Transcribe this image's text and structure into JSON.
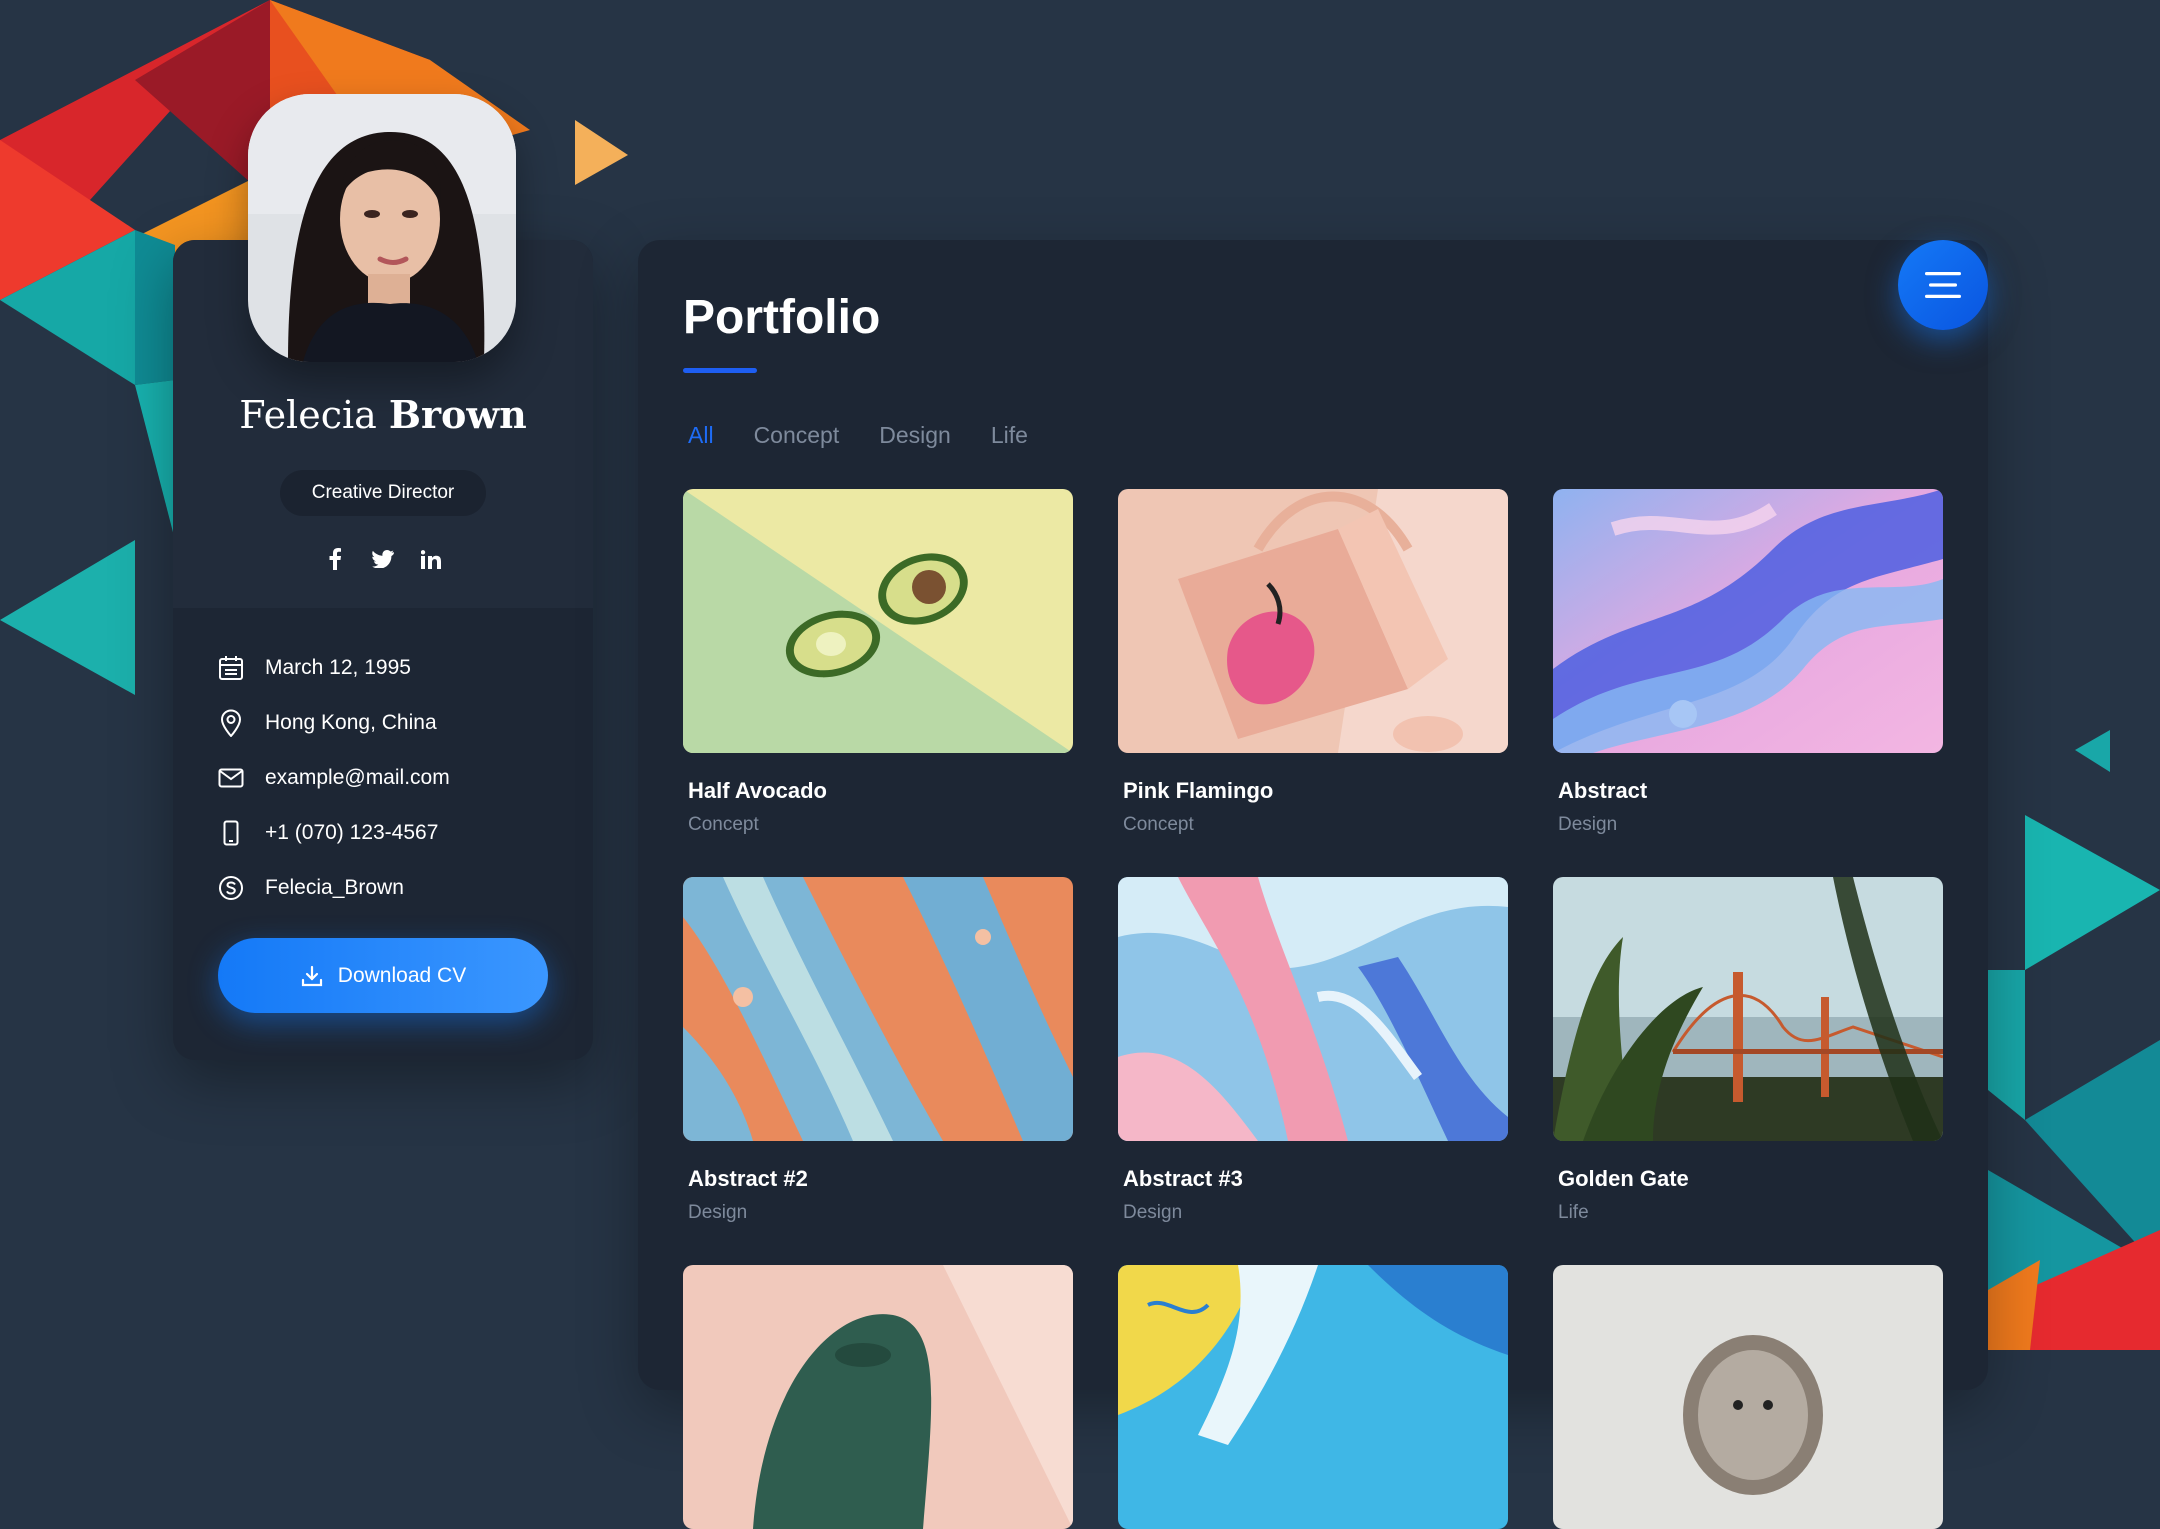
{
  "profile": {
    "first_name": "Felecia",
    "last_name": "Brown",
    "role": "Creative Director",
    "social": [
      {
        "icon": "facebook-icon",
        "label": "f"
      },
      {
        "icon": "twitter-icon",
        "label": "t"
      },
      {
        "icon": "linkedin-icon",
        "label": "in"
      }
    ],
    "info": [
      {
        "icon": "calendar-icon",
        "text": "March 12, 1995"
      },
      {
        "icon": "location-pin-icon",
        "text": "Hong Kong, China"
      },
      {
        "icon": "mail-icon",
        "text": "example@mail.com"
      },
      {
        "icon": "phone-icon",
        "text": "+1 (070) 123-4567"
      },
      {
        "icon": "skype-icon",
        "text": "Felecia_Brown"
      }
    ],
    "download_label": "Download CV"
  },
  "portfolio": {
    "title": "Portfolio",
    "filters": [
      "All",
      "Concept",
      "Design",
      "Life"
    ],
    "active_filter": "All",
    "items": [
      {
        "title": "Half Avocado",
        "category": "Concept"
      },
      {
        "title": "Pink Flamingo",
        "category": "Concept"
      },
      {
        "title": "Abstract",
        "category": "Design"
      },
      {
        "title": "Abstract #2",
        "category": "Design"
      },
      {
        "title": "Abstract #3",
        "category": "Design"
      },
      {
        "title": "Golden Gate",
        "category": "Life"
      },
      {
        "title": "",
        "category": ""
      },
      {
        "title": "",
        "category": ""
      },
      {
        "title": "",
        "category": ""
      }
    ]
  },
  "colors": {
    "background": "#263445",
    "card": "#1d2634",
    "accent": "#1479f7",
    "muted_text": "#7e8a9c"
  }
}
